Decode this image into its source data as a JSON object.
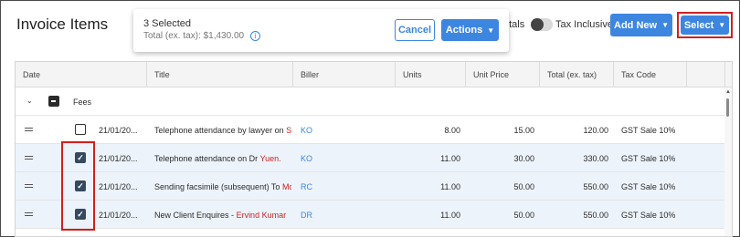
{
  "page": {
    "title": "Invoice Items"
  },
  "header": {
    "totals_label": "Totals",
    "tax_inclusive_label": "Tax Inclusive",
    "add_new_label": "Add New",
    "select_label": "Select"
  },
  "popup": {
    "selected_text": "3 Selected",
    "total_text": "Total (ex. tax): $1,430.00",
    "cancel_label": "Cancel",
    "actions_label": "Actions"
  },
  "table": {
    "columns": [
      "Date",
      "Title",
      "Biller",
      "Units",
      "Unit Price",
      "Total (ex. tax)",
      "Tax Code"
    ],
    "group_label": "Fees",
    "rows": [
      {
        "checked": false,
        "date": "21/01/20...",
        "title_main": "Telephone attendance by lawyer on",
        "title_highlight": "Sunc",
        "biller": "KO",
        "units": "8.00",
        "unit_price": "15.00",
        "total": "120.00",
        "tax_code": "GST Sale 10%"
      },
      {
        "checked": true,
        "date": "21/01/20...",
        "title_main": "Telephone attendance on Dr",
        "title_highlight": "Yuen.",
        "biller": "KO",
        "units": "11.00",
        "unit_price": "30.00",
        "total": "330.00",
        "tax_code": "GST Sale 10%"
      },
      {
        "checked": true,
        "date": "21/01/20...",
        "title_main": "Sending facsimile (subsequent) To",
        "title_highlight": "Molo",
        "biller": "RC",
        "units": "11.00",
        "unit_price": "50.00",
        "total": "550.00",
        "tax_code": "GST Sale 10%"
      },
      {
        "checked": true,
        "date": "21/01/20...",
        "title_main": "New Client Enquires -",
        "title_highlight": "Ervind Kumar",
        "biller": "DR",
        "units": "11.00",
        "unit_price": "50.00",
        "total": "550.00",
        "tax_code": "GST Sale 10%"
      }
    ]
  },
  "colors": {
    "accent": "#3d86e0",
    "highlight_red": "#d0201f",
    "checked_row_bg": "#edf3fb"
  },
  "icons": {
    "expand": "chevron-down-icon",
    "drag": "drag-handle-icon",
    "info": "info-icon",
    "dropdown": "chevron-down-icon"
  }
}
